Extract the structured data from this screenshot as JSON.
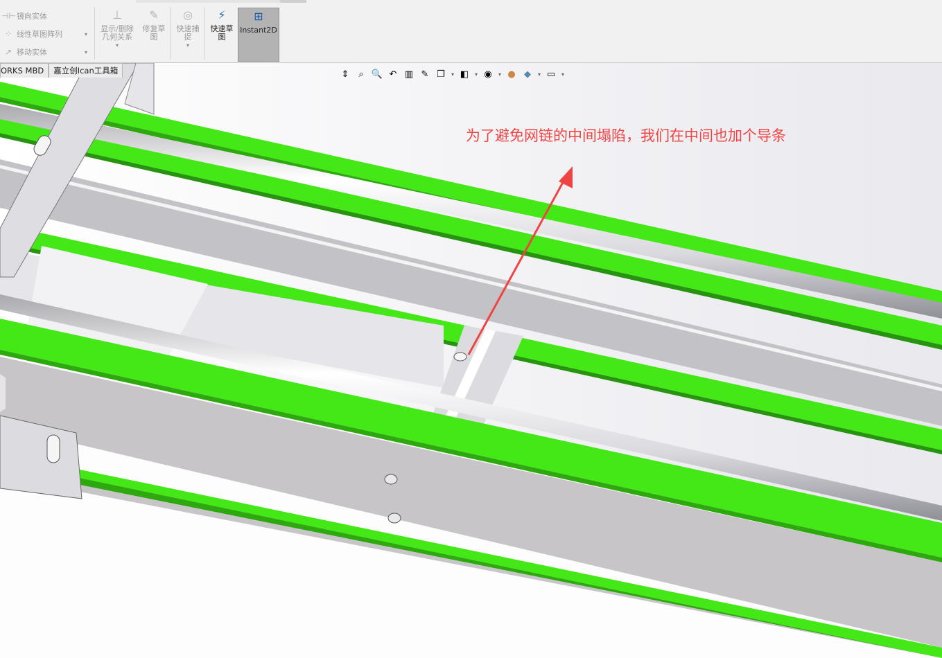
{
  "ribbon": {
    "menu_items": [
      {
        "label": "镜向实体",
        "icon": "mirror-entities-icon"
      },
      {
        "label": "线性草图阵列",
        "icon": "linear-pattern-icon"
      },
      {
        "label": "移动实体",
        "icon": "move-entities-icon"
      }
    ],
    "show_delete_relations": "显示/删除\n几何关系",
    "repair_sketch": "修复草\n图",
    "quick_snaps": "快速捕\n捉",
    "rapid_sketch": "快速草\n图",
    "instant2d": "Instant2D"
  },
  "tabs": [
    {
      "label": "ORKS MBD"
    },
    {
      "label": "嘉立创Ican工具箱"
    }
  ],
  "headsup_icons": [
    "view-orientation-icon",
    "zoom-to-fit-icon",
    "zoom-area-icon",
    "previous-view-icon",
    "section-view-icon",
    "dynamic-annotation-icon",
    "view-orientation-cube-icon",
    "display-style-icon",
    "hide-show-icon",
    "edit-appearance-icon",
    "apply-scene-icon",
    "view-settings-icon"
  ],
  "annotation": {
    "text": "为了避免网链的中间塌陷，我们在中间也加个导条",
    "color": "#ee4444"
  },
  "colors": {
    "guide_green": "#44e817",
    "frame_gray": "#c7c5c8",
    "rod_silver": "#e8e8ec"
  }
}
